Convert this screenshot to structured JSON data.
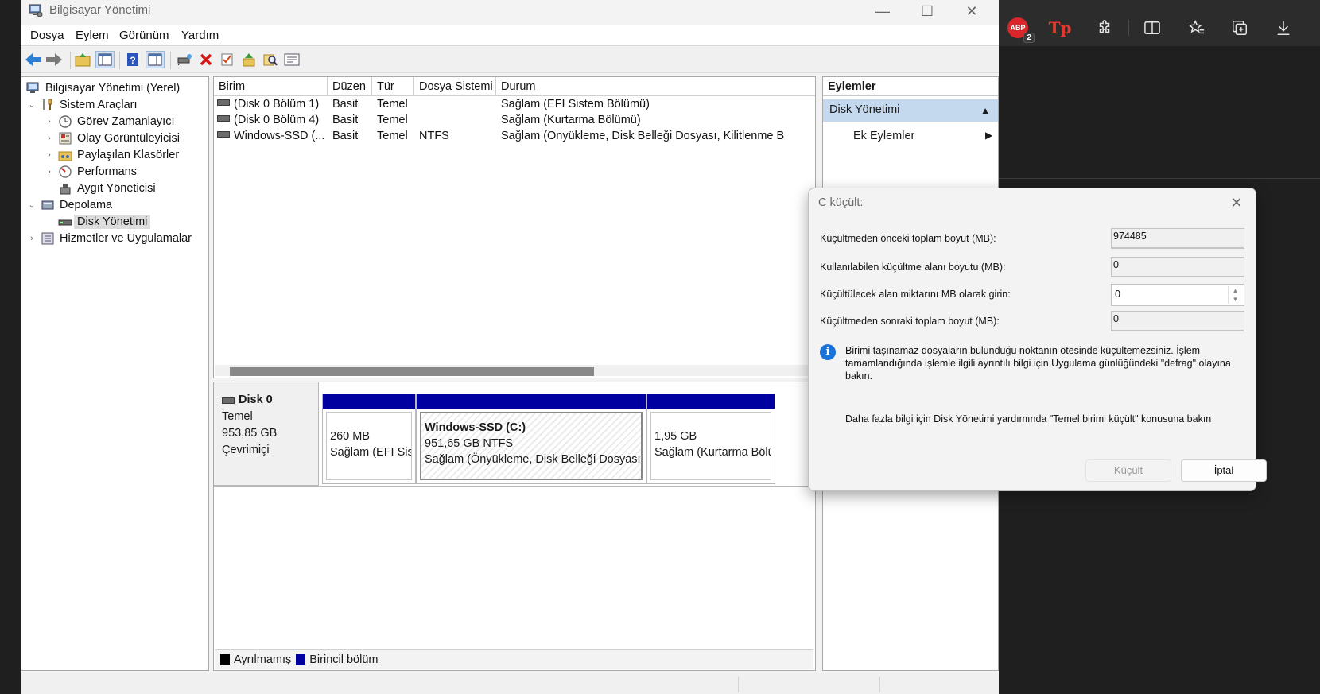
{
  "window": {
    "title": "Bilgisayar Yönetimi",
    "controls": {
      "minimize": "—",
      "maximize": "☐",
      "close": "✕"
    }
  },
  "menu": [
    "Dosya",
    "Eylem",
    "Görünüm",
    "Yardım"
  ],
  "toolbar_icons": [
    "back-icon",
    "forward-icon",
    "up-folder-icon",
    "show-hide-tree-icon",
    "help-icon",
    "properties-icon",
    "connect-icon",
    "delete-icon",
    "check-icon",
    "import-icon",
    "search-icon",
    "list-icon"
  ],
  "tree": {
    "root": "Bilgisayar Yönetimi (Yerel)",
    "items": [
      {
        "label": "Sistem Araçları",
        "level": 1,
        "expanded": true
      },
      {
        "label": "Görev Zamanlayıcı",
        "level": 2,
        "expander": true
      },
      {
        "label": "Olay Görüntüleyicisi",
        "level": 2,
        "expander": true
      },
      {
        "label": "Paylaşılan Klasörler",
        "level": 2,
        "expander": true
      },
      {
        "label": "Performans",
        "level": 2,
        "expander": true
      },
      {
        "label": "Aygıt Yöneticisi",
        "level": 2,
        "expander": false
      },
      {
        "label": "Depolama",
        "level": 1,
        "expanded": true
      },
      {
        "label": "Disk Yönetimi",
        "level": 2,
        "expander": false,
        "selected": true
      },
      {
        "label": "Hizmetler ve Uygulamalar",
        "level": 1,
        "expanded": false
      }
    ]
  },
  "volumes": {
    "columns": [
      "Birim",
      "Düzen",
      "Tür",
      "Dosya Sistemi",
      "Durum"
    ],
    "rows": [
      [
        "(Disk 0 Bölüm 1)",
        "Basit",
        "Temel",
        "",
        "Sağlam (EFI Sistem Bölümü)"
      ],
      [
        "(Disk 0 Bölüm 4)",
        "Basit",
        "Temel",
        "",
        "Sağlam (Kurtarma Bölümü)"
      ],
      [
        "Windows-SSD (...",
        "Basit",
        "Temel",
        "NTFS",
        "Sağlam (Önyükleme, Disk Belleği Dosyası, Kilitlenme B"
      ]
    ]
  },
  "disk": {
    "name": "Disk 0",
    "type": "Temel",
    "size": "953,85 GB",
    "status": "Çevrimiçi",
    "partitions": [
      {
        "name": "",
        "size": "260 MB",
        "status": "Sağlam (EFI Sist"
      },
      {
        "name": "Windows-SSD  (C:)",
        "size": "951,65 GB NTFS",
        "status": "Sağlam (Önyükleme, Disk Belleği Dosyası, K"
      },
      {
        "name": "",
        "size": "1,95 GB",
        "status": "Sağlam (Kurtarma Bölü"
      }
    ]
  },
  "legend": [
    {
      "label": "Ayrılmamış",
      "color": "#000000"
    },
    {
      "label": "Birincil bölüm",
      "color": "#0000a0"
    }
  ],
  "actions": {
    "header": "Eylemler",
    "section": "Disk Yönetimi",
    "item": "Ek Eylemler"
  },
  "dialog": {
    "title": "C küçült:",
    "fields": [
      {
        "label": "Küçültmeden önceki toplam boyut (MB):",
        "value": "974485"
      },
      {
        "label": "Kullanılabilen küçültme alanı boyutu (MB):",
        "value": "0"
      },
      {
        "label": "Küçültülecek alan miktarını MB olarak girin:",
        "value": "0"
      },
      {
        "label": "Küçültmeden sonraki toplam boyut (MB):",
        "value": "0"
      }
    ],
    "info_lines": [
      "Birimi taşınamaz dosyaların bulunduğu noktanın ötesinde küçültemezsiniz. İşlem",
      "tamamlandığında işlemle ilgili ayrıntılı bilgi için Uygulama günlüğündeki \"defrag\" olayına",
      "bakın."
    ],
    "help_text": "Daha fazla bilgi için Disk Yönetimi yardımında \"Temel birimi küçült\" konusuna bakın",
    "shrink_button": "Küçült",
    "cancel_button": "İptal"
  },
  "browser_extensions": {
    "adblock": {
      "label": "ABP",
      "count": "2"
    },
    "tp": "Tp"
  },
  "colors": {
    "primary_partition": "#0000a0",
    "selected_action": "#c5d9ee",
    "info": "#1a73d9",
    "tp_red": "#e23a2e"
  }
}
